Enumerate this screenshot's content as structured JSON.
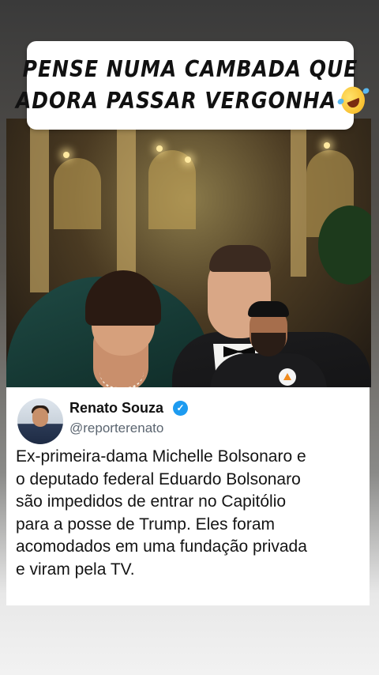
{
  "headline": {
    "line1": "PENSE NUMA CAMBADA QUE",
    "line2": "ADORA PASSAR VERGONHA"
  },
  "icons": {
    "emoji": "rolling-on-floor-laughing-icon",
    "verified": "verified-badge-icon"
  },
  "tweet": {
    "author_name": "Renato Souza",
    "author_handle": "@reporterenato",
    "verified_mark": "✓",
    "lines": [
      "Ex-primeira-dama Michelle Bolsonaro e",
      "o deputado federal Eduardo Bolsonaro",
      "são impedidos de entrar no Capitólio",
      "para a posse de Trump. Eles foram",
      "acomodados em uma fundação privada",
      "e viram pela TV."
    ]
  },
  "colors": {
    "verified_blue": "#1d9bf0",
    "dress_green": "#1f4a44"
  }
}
